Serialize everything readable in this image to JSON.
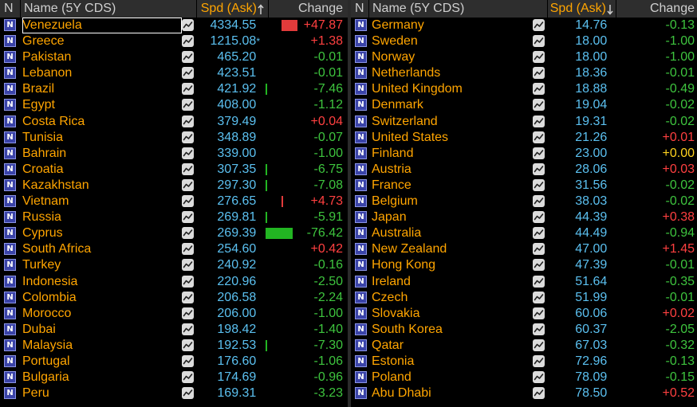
{
  "left": {
    "header": {
      "n": "N",
      "name": "Name (5Y CDS)",
      "spd": "Spd (Ask)",
      "sort_icon": "arrow-up",
      "change": "Change"
    },
    "rows": [
      {
        "name": "Venezuela",
        "spd": "4334.55",
        "change": "+47.87",
        "bar": {
          "dir": "pos",
          "frac": 0.17
        },
        "selected": true
      },
      {
        "name": "Greece",
        "spd": "1215.08",
        "star": "*",
        "change": "+1.38"
      },
      {
        "name": "Pakistan",
        "spd": "465.20",
        "change": "-0.01"
      },
      {
        "name": "Lebanon",
        "spd": "423.51",
        "change": "-0.01"
      },
      {
        "name": "Brazil",
        "spd": "421.92",
        "change": "-7.46",
        "bar": {
          "dir": "neg",
          "frac": 0.02
        }
      },
      {
        "name": "Egypt",
        "spd": "408.00",
        "change": "-1.12"
      },
      {
        "name": "Costa Rica",
        "spd": "379.49",
        "change": "+0.04"
      },
      {
        "name": "Tunisia",
        "spd": "348.89",
        "change": "-0.07"
      },
      {
        "name": "Bahrain",
        "spd": "339.00",
        "change": "-1.00"
      },
      {
        "name": "Croatia",
        "spd": "307.35",
        "change": "-6.75",
        "bar": {
          "dir": "neg",
          "frac": 0.01
        }
      },
      {
        "name": "Kazakhstan",
        "spd": "297.30",
        "change": "-7.08",
        "bar": {
          "dir": "neg",
          "frac": 0.01
        }
      },
      {
        "name": "Vietnam",
        "spd": "276.65",
        "change": "+4.73",
        "bar": {
          "dir": "pos",
          "frac": 0.01
        }
      },
      {
        "name": "Russia",
        "spd": "269.81",
        "change": "-5.91",
        "bar": {
          "dir": "neg",
          "frac": 0.01
        }
      },
      {
        "name": "Cyprus",
        "spd": "269.39",
        "change": "-76.42",
        "bar": {
          "dir": "neg",
          "frac": 0.28
        }
      },
      {
        "name": "South Africa",
        "spd": "254.60",
        "change": "+0.42"
      },
      {
        "name": "Turkey",
        "spd": "240.92",
        "change": "-0.16"
      },
      {
        "name": "Indonesia",
        "spd": "220.96",
        "change": "-2.50"
      },
      {
        "name": "Colombia",
        "spd": "206.58",
        "change": "-2.24"
      },
      {
        "name": "Morocco",
        "spd": "206.00",
        "change": "-1.00"
      },
      {
        "name": "Dubai",
        "spd": "198.42",
        "change": "-1.40"
      },
      {
        "name": "Malaysia",
        "spd": "192.53",
        "change": "-7.30",
        "bar": {
          "dir": "neg",
          "frac": 0.01
        }
      },
      {
        "name": "Portugal",
        "spd": "176.60",
        "change": "-1.06"
      },
      {
        "name": "Bulgaria",
        "spd": "174.69",
        "change": "-0.96"
      },
      {
        "name": "Peru",
        "spd": "169.31",
        "change": "-3.23"
      }
    ]
  },
  "right": {
    "header": {
      "n": "N",
      "name": "Name (5Y CDS)",
      "spd": "Spd (Ask)",
      "sort_icon": "arrow-down",
      "change": "Change"
    },
    "rows": [
      {
        "name": "Germany",
        "spd": "14.76",
        "change": "-0.13"
      },
      {
        "name": "Sweden",
        "spd": "18.00",
        "change": "-1.00"
      },
      {
        "name": "Norway",
        "spd": "18.00",
        "change": "-1.00"
      },
      {
        "name": "Netherlands",
        "spd": "18.36",
        "change": "-0.01"
      },
      {
        "name": "United Kingdom",
        "spd": "18.88",
        "change": "-0.49"
      },
      {
        "name": "Denmark",
        "spd": "19.04",
        "change": "-0.02"
      },
      {
        "name": "Switzerland",
        "spd": "19.31",
        "change": "-0.02"
      },
      {
        "name": "United States",
        "spd": "21.26",
        "change": "+0.01"
      },
      {
        "name": "Finland",
        "spd": "23.00",
        "change": "+0.00"
      },
      {
        "name": "Austria",
        "spd": "28.06",
        "change": "+0.03"
      },
      {
        "name": "France",
        "spd": "31.56",
        "change": "-0.02"
      },
      {
        "name": "Belgium",
        "spd": "38.03",
        "change": "-0.02"
      },
      {
        "name": "Japan",
        "spd": "44.39",
        "change": "+0.38"
      },
      {
        "name": "Australia",
        "spd": "44.49",
        "change": "-0.94"
      },
      {
        "name": "New Zealand",
        "spd": "47.00",
        "change": "+1.45"
      },
      {
        "name": "Hong Kong",
        "spd": "47.39",
        "change": "-0.01"
      },
      {
        "name": "Ireland",
        "spd": "51.64",
        "change": "-0.35"
      },
      {
        "name": "Czech",
        "spd": "51.99",
        "change": "-0.01"
      },
      {
        "name": "Slovakia",
        "spd": "60.06",
        "change": "+0.02"
      },
      {
        "name": "South Korea",
        "spd": "60.37",
        "change": "-2.05"
      },
      {
        "name": "Qatar",
        "spd": "67.03",
        "change": "-0.32"
      },
      {
        "name": "Estonia",
        "spd": "72.96",
        "change": "-0.13"
      },
      {
        "name": "Poland",
        "spd": "78.09",
        "change": "-0.15"
      },
      {
        "name": "Abu Dhabi",
        "spd": "78.50",
        "change": "+0.52"
      }
    ]
  },
  "colors": {
    "name": "#ffa500",
    "spd": "#5bc0f0",
    "negative": "#3ec43e",
    "positive": "#ff4040",
    "zero": "#ffd21f",
    "news_icon": "#3a43a8",
    "header_bg": "#2e2e2e"
  },
  "icons": {
    "news": "news-n-icon",
    "chart": "chart-line-icon"
  }
}
